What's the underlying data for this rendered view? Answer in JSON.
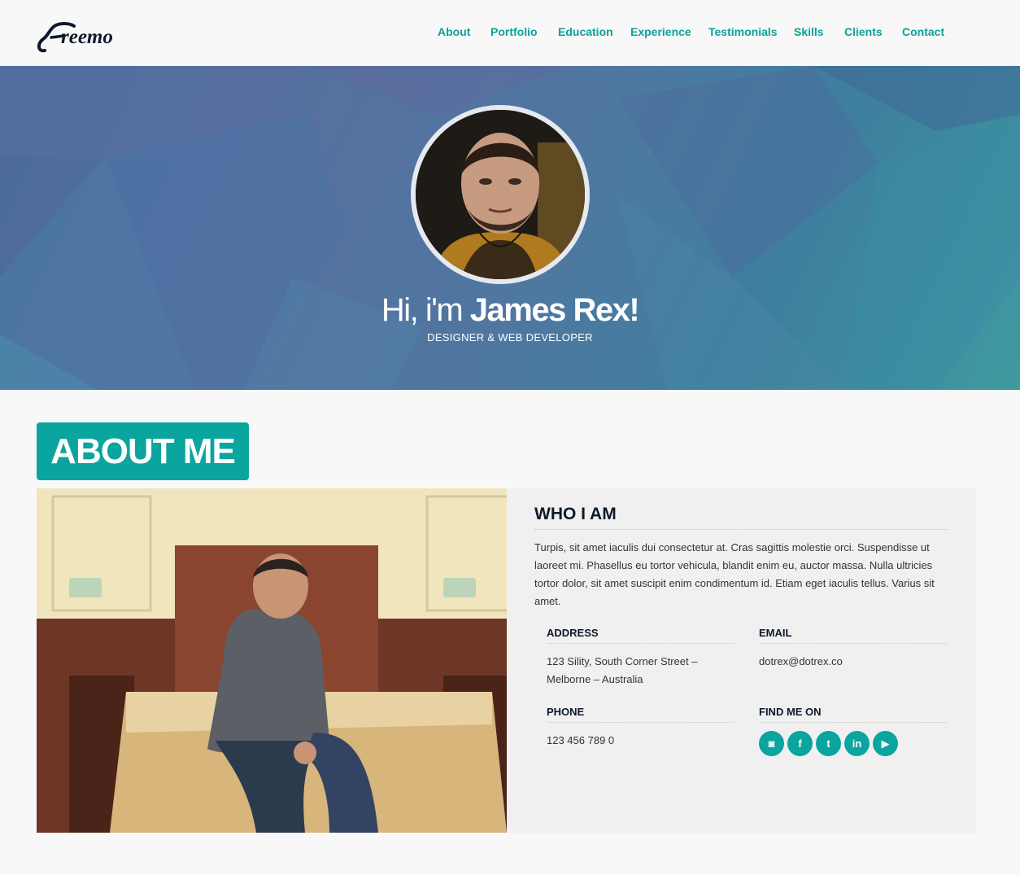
{
  "brand": {
    "logo_text": "Freemo"
  },
  "nav": {
    "items": [
      {
        "label": "About"
      },
      {
        "label": "Portfolio"
      },
      {
        "label": "Education"
      },
      {
        "label": "Experience"
      },
      {
        "label": "Testimonials"
      },
      {
        "label": "Skills"
      },
      {
        "label": "Clients"
      },
      {
        "label": "Contact"
      }
    ]
  },
  "hero": {
    "greeting": "Hi, i'm",
    "name": "James Rex!",
    "subtitle": "DESIGNER & WEB DEVELOPER"
  },
  "about": {
    "section_title": "ABOUT ME",
    "who_title": "WHO I AM",
    "who_text": "Turpis, sit amet iaculis dui consectetur at. Cras sagittis molestie orci. Suspendisse ut laoreet mi. Phasellus eu tortor vehicula, blandit enim eu, auctor massa. Nulla ultricies tortor dolor, sit amet suscipit enim condimentum id. Etiam eget iaculis tellus. Varius sit amet.",
    "address_label": "ADDRESS",
    "address_value": "123 Sility, South Corner Street – Melborne – Australia",
    "email_label": "EMAIL",
    "email_value": "dotrex@dotrex.co",
    "phone_label": "PHONE",
    "phone_value": "123 456 789 0",
    "social_label": "FIND ME ON",
    "socials": [
      {
        "icon": "instagram-icon",
        "glyph": "◙"
      },
      {
        "icon": "facebook-icon",
        "glyph": "f"
      },
      {
        "icon": "twitter-icon",
        "glyph": "t"
      },
      {
        "icon": "linkedin-icon",
        "glyph": "in"
      },
      {
        "icon": "youtube-icon",
        "glyph": "▶"
      }
    ]
  },
  "colors": {
    "accent": "#0aa59e",
    "nav_link": "#0aa19a",
    "heading": "#0e1a2b"
  }
}
